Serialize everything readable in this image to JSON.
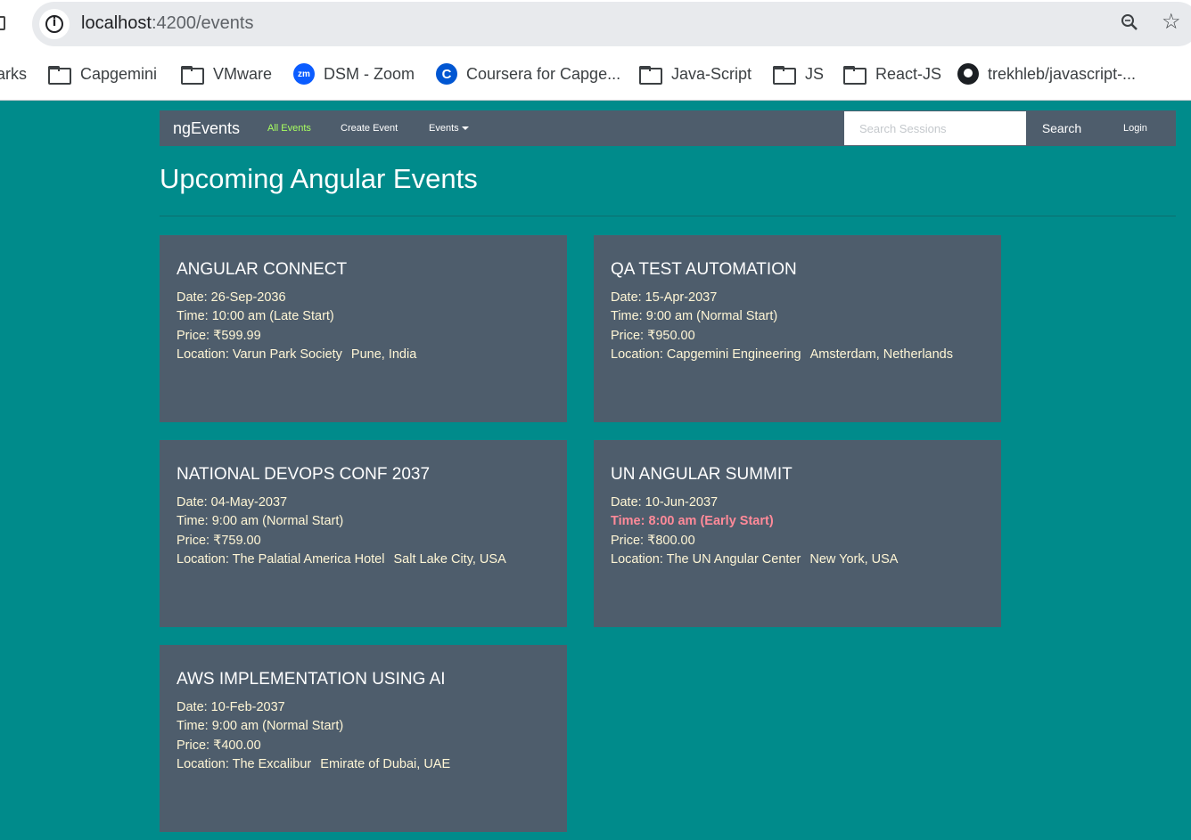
{
  "browser": {
    "url_host": "localhost",
    "url_path": ":4200/events",
    "bookmarks": [
      {
        "label": "arks",
        "icon": "none"
      },
      {
        "label": "Capgemini",
        "icon": "folder-icon"
      },
      {
        "label": "VMware",
        "icon": "folder-icon"
      },
      {
        "label": "DSM - Zoom",
        "icon": "zoom-icon",
        "badge": "zm"
      },
      {
        "label": "Coursera for Capge...",
        "icon": "coursera-icon",
        "badge": "C"
      },
      {
        "label": "Java-Script",
        "icon": "folder-icon"
      },
      {
        "label": "JS",
        "icon": "folder-icon"
      },
      {
        "label": "React-JS",
        "icon": "folder-icon"
      },
      {
        "label": "trekhleb/javascript-...",
        "icon": "github-icon"
      }
    ]
  },
  "navbar": {
    "brand": "ngEvents",
    "links": [
      {
        "label": "All Events",
        "active": true
      },
      {
        "label": "Create Event",
        "active": false
      },
      {
        "label": "Events",
        "active": false
      }
    ],
    "search_placeholder": "Search Sessions",
    "search_button": "Search",
    "login": "Login"
  },
  "colors": {
    "page_bg": "#008b8b",
    "card_bg": "#4e5d6c",
    "card_text": "#fff6d5",
    "active_link": "#a8ff60",
    "early_start": "#ff8a99"
  },
  "page": {
    "title": "Upcoming Angular Events"
  },
  "events": [
    {
      "name": "ANGULAR CONNECT",
      "date": "Date: 26-Sep-2036",
      "time": "Time: 10:00 am (Late Start)",
      "early": false,
      "price": "Price: ₹599.99",
      "location_label": "Location: Varun Park Society",
      "location_city": "Pune, India"
    },
    {
      "name": "QA TEST AUTOMATION",
      "date": "Date: 15-Apr-2037",
      "time": "Time: 9:00 am (Normal Start)",
      "early": false,
      "price": "Price: ₹950.00",
      "location_label": "Location: Capgemini Engineering",
      "location_city": "Amsterdam, Netherlands"
    },
    {
      "name": "NATIONAL DEVOPS CONF 2037",
      "date": "Date: 04-May-2037",
      "time": "Time: 9:00 am (Normal Start)",
      "early": false,
      "price": "Price: ₹759.00",
      "location_label": "Location: The Palatial America Hotel",
      "location_city": "Salt Lake City, USA"
    },
    {
      "name": "UN ANGULAR SUMMIT",
      "date": "Date: 10-Jun-2037",
      "time": "Time: 8:00 am (Early Start)",
      "early": true,
      "price": "Price: ₹800.00",
      "location_label": "Location: The UN Angular Center",
      "location_city": "New York, USA"
    },
    {
      "name": "AWS IMPLEMENTATION USING AI",
      "date": "Date: 10-Feb-2037",
      "time": "Time: 9:00 am (Normal Start)",
      "early": false,
      "price": "Price: ₹400.00",
      "location_label": "Location: The Excalibur",
      "location_city": "Emirate of Dubai, UAE"
    }
  ]
}
